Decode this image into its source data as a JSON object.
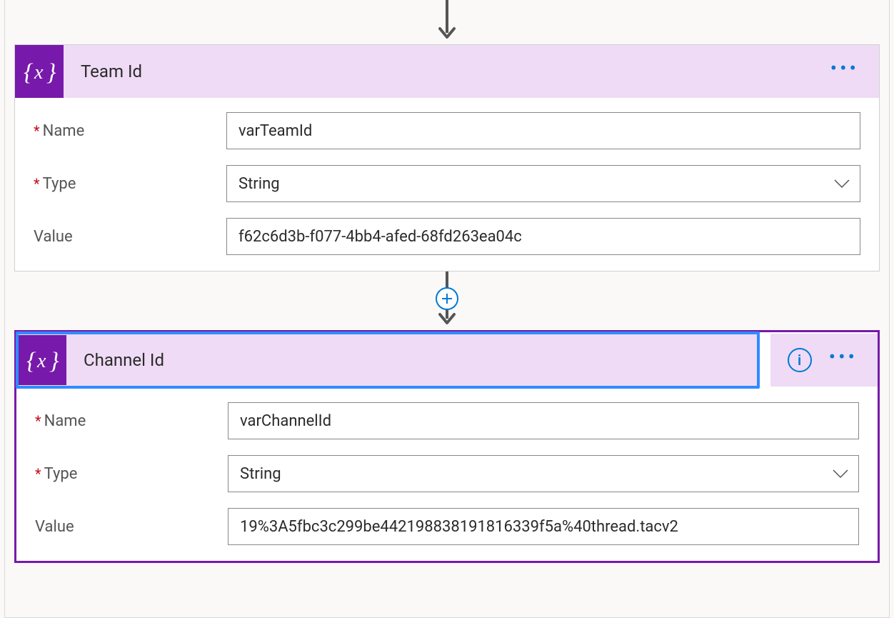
{
  "colors": {
    "accent_purple": "#7719aa",
    "header_lavender": "#efdbf5",
    "link_blue": "#0078d4",
    "arrow_gray": "#555555",
    "required_red": "#c50f1f",
    "focus_blue": "#2f8cff"
  },
  "icons": {
    "variable": "variable-icon",
    "info": "info-icon",
    "more": "more-icon",
    "add": "plus-icon",
    "chevron_down": "chevron-down-icon",
    "arrow_down": "arrow-down-icon"
  },
  "labels": {
    "name": "Name",
    "type": "Type",
    "value": "Value"
  },
  "actions": [
    {
      "id": "team-id",
      "title": "Team Id",
      "selected": false,
      "show_info": false,
      "fields": {
        "name": "varTeamId",
        "type": "String",
        "value": "f62c6d3b-f077-4bb4-afed-68fd263ea04c"
      }
    },
    {
      "id": "channel-id",
      "title": "Channel Id",
      "selected": true,
      "show_info": true,
      "fields": {
        "name": "varChannelId",
        "type": "String",
        "value": "19%3A5fbc3c299be442198838191816339f5a%40thread.tacv2"
      }
    }
  ]
}
